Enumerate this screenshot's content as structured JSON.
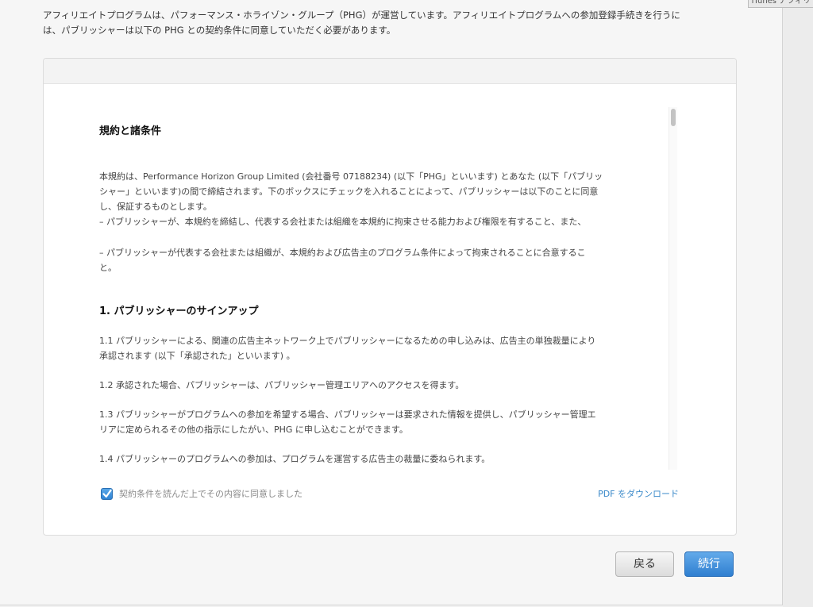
{
  "corner_tooltip": "iTunes アフィリ",
  "intro": {
    "line1": "アフィリエイトプログラムは、パフォーマンス・ホライゾン・グループ（PHG）が運営しています。アフィリエイトプログラムへの参加登録手続きを行うに",
    "line2": "は、パブリッシャーは以下の PHG との契約条件に同意していただく必要があります。"
  },
  "doc": {
    "title": "規約と諸条件",
    "para1": {
      "l1": "本規約は、Performance Horizon Group Limited (会社番号 07188234) (以下「PHG」といいます) とあなた (以下「パブリッ",
      "l2": "シャー」といいます)の間で締結されます。下のボックスにチェックを入れることによって、パブリッシャーは以下のことに同意",
      "l3": "し、保証するものとします。",
      "l4": "– パブリッシャーが、本規約を締結し、代表する会社または組織を本規約に拘束させる能力および権限を有すること、また、"
    },
    "para2": {
      "l1": "– パブリッシャーが代表する会社または組織が、本規約および広告主のプログラム条件によって拘束されることに合意するこ",
      "l2": "と。"
    },
    "section1_title": "1. パブリッシャーのサインアップ",
    "s1_1": {
      "l1": "1.1 パブリッシャーによる、関連の広告主ネットワーク上でパブリッシャーになるための申し込みは、広告主の単独裁量により",
      "l2": "承認されます (以下「承認された」といいます) 。"
    },
    "s1_2": "1.2 承認された場合、パブリッシャーは、パブリッシャー管理エリアへのアクセスを得ます。",
    "s1_3": {
      "l1": "1.3 パブリッシャーがプログラムへの参加を希望する場合、パブリッシャーは要求された情報を提供し、パブリッシャー管理エ",
      "l2": "リアに定められるその他の指示にしたがい、PHG に申し込むことができます。"
    },
    "s1_4": "1.4 パブリッシャーのプログラムへの参加は、プログラムを運営する広告主の裁量に委ねられます。"
  },
  "agree_label": "契約条件を読んだ上でその内容に同意しました",
  "agree_checked": true,
  "pdf_link": "PDF をダウンロード",
  "buttons": {
    "back": "戻る",
    "next": "続行"
  },
  "colors": {
    "accent_link": "#3a89c9",
    "primary_button": "#3f8fde",
    "checkbox": "#3a8ad8"
  },
  "icons": {
    "checkbox": "checkmark-icon"
  }
}
